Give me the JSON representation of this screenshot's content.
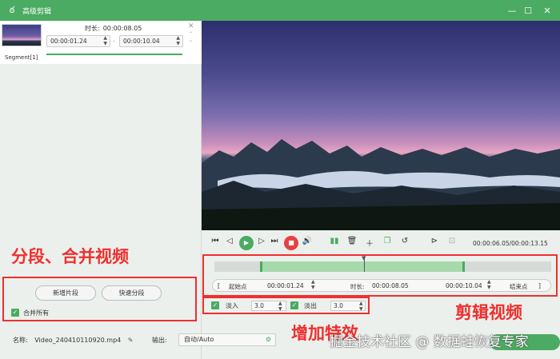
{
  "window": {
    "title": "高级剪辑",
    "controls": [
      "minimize-icon",
      "maximize-icon",
      "close-icon"
    ]
  },
  "segment": {
    "duration_label": "时长:",
    "duration_value": "00:00:08.05",
    "start": "00:00:01.24",
    "end": "00:00:10.04",
    "separator": "-",
    "name": "Segment[1]"
  },
  "left_actions": {
    "new_clip": "新增片段",
    "quick_split": "快速分段",
    "merge_all": "合并所有"
  },
  "player": {
    "timecode": "00:00:06.05/00:00:13.15"
  },
  "trim": {
    "start_point": "起始点",
    "start_value": "00:00:01.24",
    "duration_label": "时长:",
    "duration_value": "00:00:08.05",
    "end_value": "00:00:10.04",
    "end_point": "结束点",
    "bracket_left": "[",
    "bracket_right": "]"
  },
  "effects": {
    "fade_in_label": "淡入",
    "fade_in_value": "3.0",
    "fade_out_label": "淡出",
    "fade_out_value": "3.0"
  },
  "footer": {
    "name_label": "名称:",
    "filename": "Video_240410110920.mp4",
    "output_label": "输出:",
    "output_value": "自动/Auto"
  },
  "annotations": {
    "split_merge": "分段、合并视频",
    "edit_video": "剪辑视频",
    "add_effects": "增加特效"
  },
  "watermark": "掘金技术社区 @ 数据蛙恢复专家",
  "colors": {
    "accent": "#4bab62",
    "annotation": "#ef2f2f",
    "stop": "#e84040"
  }
}
